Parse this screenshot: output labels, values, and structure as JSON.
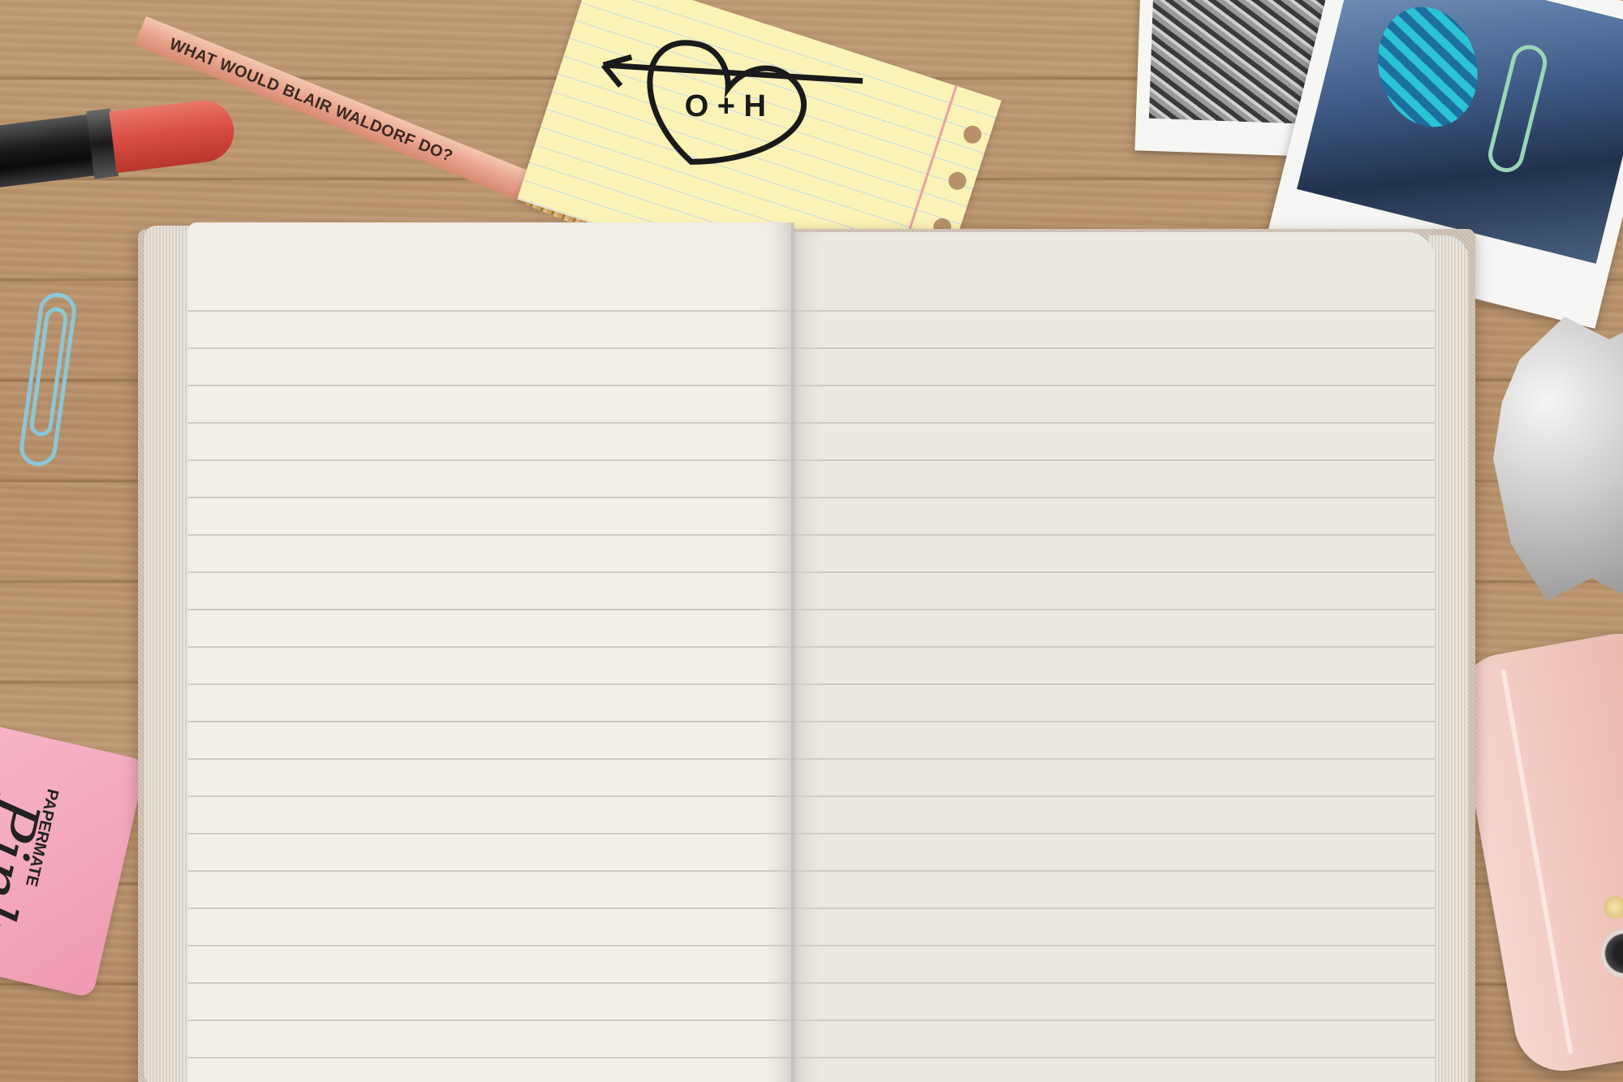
{
  "scene": {
    "pencil_text": "WHAT WOULD BLAIR WALDORF DO?",
    "note_doodle": "O + H",
    "eraser_brand": "PAPERMATE",
    "eraser_script": "Pink"
  },
  "notebook": {
    "left_page_lines": 22,
    "right_page_lines": 22
  },
  "colors": {
    "desk": "#bd9870",
    "page": "#f2efe9",
    "rule": "#cfcbc4",
    "lipstick": "#d94f45",
    "pencil": "#e9a48e",
    "note": "#fbf3b6",
    "phone": "#efc4bb",
    "eraser": "#f09ab2",
    "clip_blue": "#8cc7d6",
    "clip_green": "#9ad6b8"
  },
  "icons": [
    "lipstick-icon",
    "pencil-icon",
    "paperclip-icon",
    "photo-icon",
    "phone-icon",
    "eraser-icon"
  ]
}
